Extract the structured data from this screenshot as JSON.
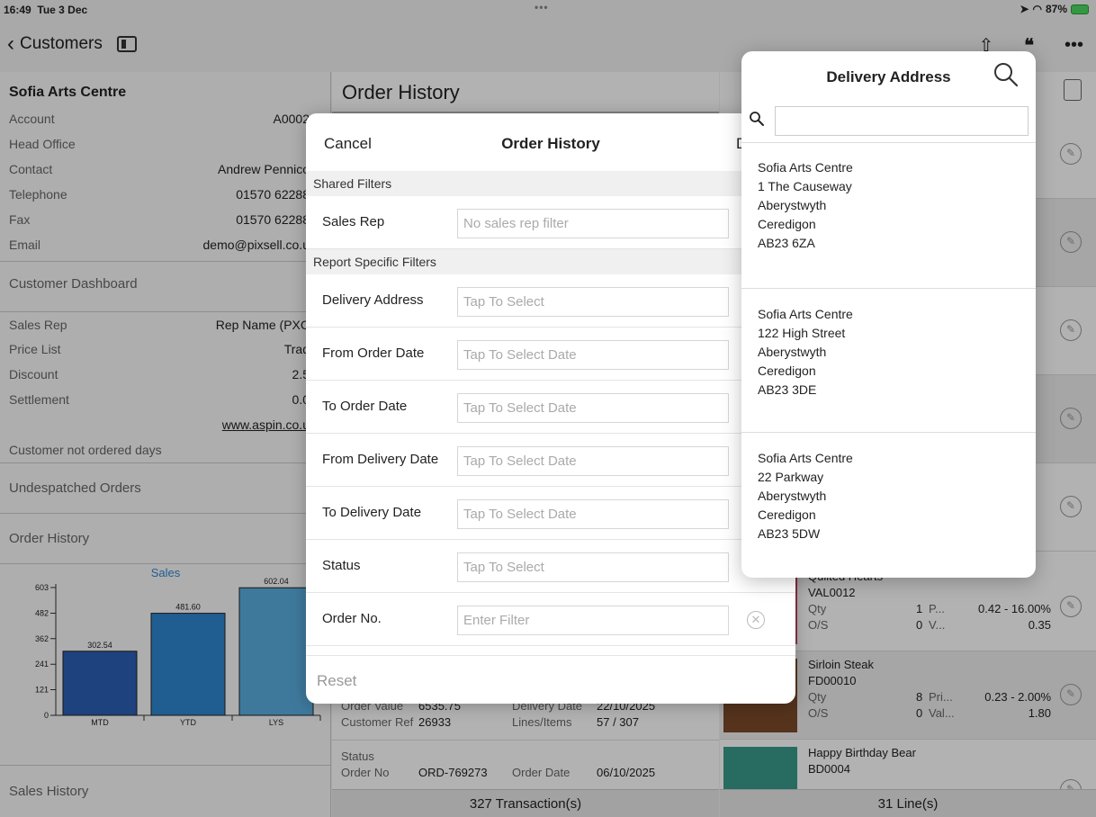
{
  "status_bar": {
    "time": "16:49",
    "date": "Tue 3 Dec",
    "battery": "87%"
  },
  "navbar": {
    "back_label": "Customers"
  },
  "customer": {
    "name": "Sofia Arts Centre",
    "details": [
      {
        "key": "Account",
        "value": "A0002"
      },
      {
        "key": "Head Office",
        "value": ""
      },
      {
        "key": "Contact",
        "value": "Andrew Pennico"
      },
      {
        "key": "Telephone",
        "value": "01570 62288"
      },
      {
        "key": "Fax",
        "value": "01570 62288"
      },
      {
        "key": "Email",
        "value": "demo@pixsell.co.u"
      }
    ],
    "dashboard_label": "Customer Dashboard",
    "terms": [
      {
        "key": "Sales Rep",
        "value": "Rep Name (PXC"
      },
      {
        "key": "Price List",
        "value": "Trad"
      },
      {
        "key": "Discount",
        "value": "2.5"
      },
      {
        "key": "Settlement",
        "value": "0.0"
      }
    ],
    "website": "www.aspin.co.u",
    "not_ordered_label": "Customer not ordered days",
    "undespatched_label": "Undespatched Orders",
    "order_history_label": "Order History",
    "sales_history_label": "Sales History"
  },
  "chart_data": {
    "type": "bar",
    "title": "Sales",
    "categories": [
      "MTD",
      "YTD",
      "LYS"
    ],
    "values": [
      302.54,
      481.6,
      602.04
    ],
    "value_labels": [
      "302.54",
      "481.60",
      "602.04"
    ],
    "yticks": [
      0,
      121,
      241,
      362,
      482,
      603
    ],
    "ytick_labels": [
      "0",
      "121",
      "241",
      "362",
      "482",
      "603"
    ],
    "ylim": [
      0,
      603
    ],
    "colors": [
      "#2c5fb5",
      "#2f86d0",
      "#5aaee0"
    ],
    "title_color": "#2f86d0"
  },
  "center": {
    "title": "Order History",
    "order": {
      "order_value_label": "Order Value",
      "order_value": "6535.75",
      "delivery_date_label": "Delivery Date",
      "delivery_date": "22/10/2025",
      "customer_ref_label": "Customer Ref",
      "customer_ref": "26933",
      "lines_items_label": "Lines/Items",
      "lines_items": "57 / 307"
    },
    "next_order": {
      "status_label": "Status",
      "order_no_label": "Order No",
      "order_no": "ORD-769273",
      "order_date_label": "Order Date",
      "order_date": "06/10/2025"
    },
    "footer": "327 Transaction(s)"
  },
  "right": {
    "items": [
      {
        "name": "Quilted Hearts",
        "code": "VAL0012",
        "qty_label": "Qty",
        "qty": "1",
        "p_label": "P...",
        "price": "0.42 - 16.00%",
        "os_label": "O/S",
        "os": "0",
        "v_label": "V...",
        "value": "0.35"
      },
      {
        "name": "Sirloin Steak",
        "code": "FD00010",
        "qty_label": "Qty",
        "qty": "8",
        "p_label": "Pri...",
        "price": "0.23 - 2.00%",
        "os_label": "O/S",
        "os": "0",
        "v_label": "Val...",
        "value": "1.80"
      },
      {
        "name": "Happy Birthday Bear",
        "code": "BD0004"
      }
    ],
    "footer": "31 Line(s)"
  },
  "sheet": {
    "cancel": "Cancel",
    "title": "Order History",
    "done": "D",
    "shared_filters": "Shared Filters",
    "sales_rep_label": "Sales Rep",
    "sales_rep_placeholder": "No sales rep filter",
    "report_filters": "Report Specific Filters",
    "rows": [
      {
        "label": "Delivery Address",
        "placeholder": "Tap To Select"
      },
      {
        "label": "From Order Date",
        "placeholder": "Tap To Select Date"
      },
      {
        "label": "To Order Date",
        "placeholder": "Tap To Select Date"
      },
      {
        "label": "From Delivery Date",
        "placeholder": "Tap To Select Date"
      },
      {
        "label": "To Delivery Date",
        "placeholder": "Tap To Select Date"
      },
      {
        "label": "Status",
        "placeholder": "Tap To Select"
      },
      {
        "label": "Order No.",
        "placeholder": "Enter Filter"
      }
    ],
    "reset": "Reset"
  },
  "popover": {
    "title": "Delivery Address",
    "search_value": "",
    "addresses": [
      [
        "Sofia Arts Centre",
        "1 The Causeway",
        "Aberystwyth",
        "Ceredigon",
        "AB23 6ZA"
      ],
      [
        "Sofia Arts Centre",
        "122 High Street",
        "Aberystwyth",
        "Ceredigon",
        "AB23 3DE"
      ],
      [
        "Sofia Arts Centre",
        "22 Parkway",
        "Aberystwyth",
        "Ceredigon",
        "AB23 5DW"
      ]
    ]
  }
}
